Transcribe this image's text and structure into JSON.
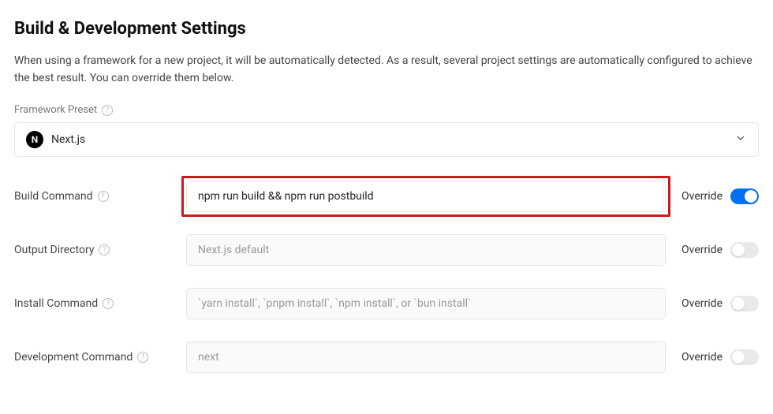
{
  "header": {
    "title": "Build & Development Settings",
    "description": "When using a framework for a new project, it will be automatically detected. As a result, several project settings are automatically configured to achieve the best result. You can override them below."
  },
  "framework_preset": {
    "label": "Framework Preset",
    "icon_letter": "N",
    "selected": "Next.js"
  },
  "override_label": "Override",
  "settings": {
    "build_command": {
      "label": "Build Command",
      "value": "npm run build && npm run postbuild",
      "placeholder": "",
      "override": true,
      "highlighted": true
    },
    "output_directory": {
      "label": "Output Directory",
      "value": "",
      "placeholder": "Next.js default",
      "override": false
    },
    "install_command": {
      "label": "Install Command",
      "value": "",
      "placeholder": "`yarn install`, `pnpm install`, `npm install`, or `bun install`",
      "override": false
    },
    "development_command": {
      "label": "Development Command",
      "value": "",
      "placeholder": "next",
      "override": false
    }
  }
}
